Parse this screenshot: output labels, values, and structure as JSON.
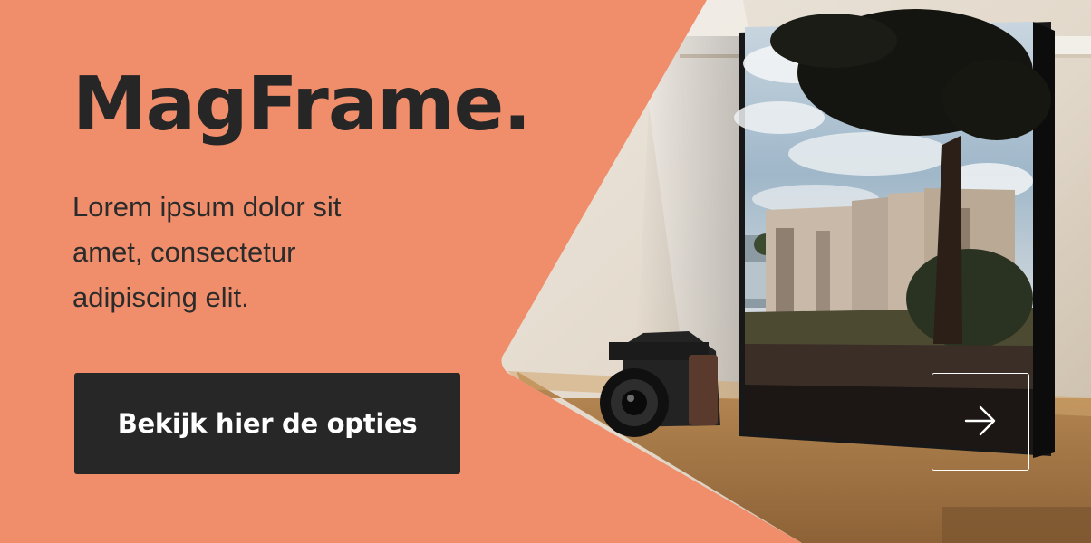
{
  "hero": {
    "title": "MagFrame.",
    "description": "Lorem ipsum dolor sit amet, consectetur adipiscing elit.",
    "cta_label": "Bekijk hier de opties"
  },
  "icons": {
    "next": "arrow-right-icon"
  },
  "colors": {
    "background": "#f08e6b",
    "text": "#262626",
    "button": "#272727",
    "button_text": "#ffffff"
  }
}
